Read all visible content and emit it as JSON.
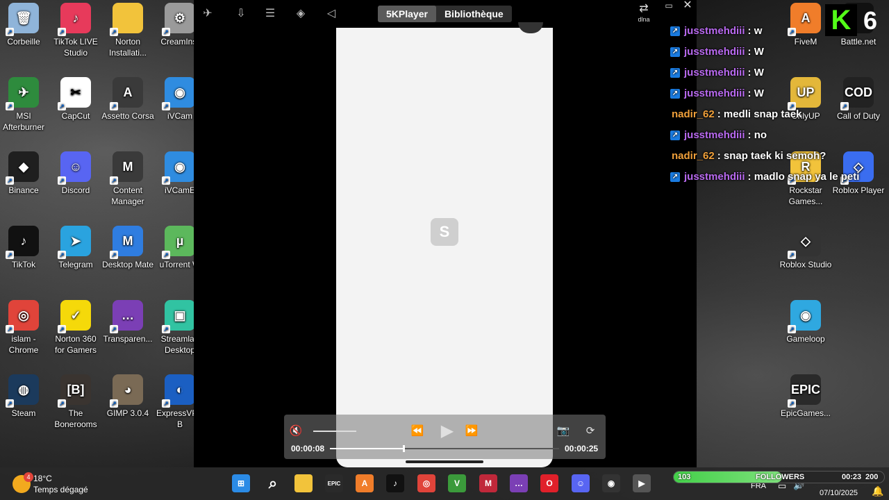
{
  "desktop_left": [
    {
      "label": "Corbeille",
      "icon": "recycle-bin-icon",
      "color": "#8fb4d9",
      "glyph": "🗑"
    },
    {
      "label": "TikTok LIVE Studio",
      "icon": "tiktok-live-studio-icon",
      "color": "#e73a5b",
      "glyph": "♪"
    },
    {
      "label": "Norton Installati...",
      "icon": "folder-icon",
      "color": "#f2c33b",
      "glyph": ""
    },
    {
      "label": "CreamInst",
      "icon": "gear-icon",
      "color": "#9a9a9a",
      "glyph": "⚙"
    },
    {
      "label": "MSI Afterburner",
      "icon": "msi-afterburner-icon",
      "color": "#2e8b3d",
      "glyph": "✈"
    },
    {
      "label": "CapCut",
      "icon": "capcut-icon",
      "color": "#ffffff",
      "glyph": "✂"
    },
    {
      "label": "Assetto Corsa",
      "icon": "assetto-corsa-icon",
      "color": "#3a3a3a",
      "glyph": "A"
    },
    {
      "label": "iVCam",
      "icon": "ivcam-icon",
      "color": "#2f8ce0",
      "glyph": "◉"
    },
    {
      "label": "Binance",
      "icon": "binance-icon",
      "color": "#1f1f1f",
      "glyph": "◆"
    },
    {
      "label": "Discord",
      "icon": "discord-icon",
      "color": "#5865f2",
      "glyph": "☺"
    },
    {
      "label": "Content Manager",
      "icon": "content-manager-icon",
      "color": "#3a3a3a",
      "glyph": "M"
    },
    {
      "label": "iVCamE",
      "icon": "ivcam-e-icon",
      "color": "#2f8ce0",
      "glyph": "◉"
    },
    {
      "label": "TikTok",
      "icon": "tiktok-icon",
      "color": "#111111",
      "glyph": "♪"
    },
    {
      "label": "Telegram",
      "icon": "telegram-icon",
      "color": "#2aa3df",
      "glyph": "➤"
    },
    {
      "label": "Desktop Mate",
      "icon": "desktop-mate-icon",
      "color": "#2f7de0",
      "glyph": "M"
    },
    {
      "label": "uTorrent W",
      "icon": "utorrent-icon",
      "color": "#5cb85c",
      "glyph": "µ"
    },
    {
      "label": "islam - Chrome",
      "icon": "chrome-icon",
      "color": "#e0443a",
      "glyph": "◎"
    },
    {
      "label": "Norton 360 for Gamers",
      "icon": "norton-360-icon",
      "color": "#f5d90a",
      "glyph": "✓"
    },
    {
      "label": "Transparen...",
      "icon": "transparent-icon",
      "color": "#7b3fb5",
      "glyph": "…"
    },
    {
      "label": "Streamlab Desktop",
      "icon": "streamlabs-icon",
      "color": "#31c3a2",
      "glyph": "▣"
    },
    {
      "label": "Steam",
      "icon": "steam-icon",
      "color": "#1b3a5c",
      "glyph": "◍"
    },
    {
      "label": "The Bonerooms",
      "icon": "bonerooms-icon",
      "color": "#3a3430",
      "glyph": "[B]"
    },
    {
      "label": "GIMP 3.0.4",
      "icon": "gimp-icon",
      "color": "#7a6a55",
      "glyph": "◕"
    },
    {
      "label": "ExpressVPN B",
      "icon": "vpn-icon",
      "color": "#1b5fc2",
      "glyph": "◐"
    }
  ],
  "desktop_right": [
    {
      "label": "FiveM",
      "icon": "fivem-icon",
      "color": "#f07d2a",
      "glyph": "A"
    },
    {
      "label": "Battle.net",
      "icon": "battlenet-icon",
      "color": "#111111",
      "glyph": ""
    },
    {
      "label": "OnlyUP",
      "icon": "onlyup-icon",
      "color": "#e3b73a",
      "glyph": "UP"
    },
    {
      "label": "Call of Duty",
      "icon": "call-of-duty-icon",
      "color": "#222222",
      "glyph": "COD"
    },
    {
      "label": "Rockstar Games...",
      "icon": "rockstar-icon",
      "color": "#f2c33b",
      "glyph": "R"
    },
    {
      "label": "Roblox Player",
      "icon": "roblox-player-icon",
      "color": "#3a6df0",
      "glyph": "◇"
    },
    {
      "label": "Roblox Studio",
      "icon": "roblox-studio-icon",
      "color": "#333333",
      "glyph": "◇"
    },
    {
      "label": "Gameloop",
      "icon": "gameloop-icon",
      "color": "#2fa8e0",
      "glyph": "◉"
    },
    {
      "label": "EpicGames...",
      "icon": "epic-games-icon",
      "color": "#2a2a2a",
      "glyph": "EPIC"
    }
  ],
  "kick_overlay": {
    "k": "K",
    "num": "6"
  },
  "player": {
    "tabs": [
      {
        "label": "5KPlayer"
      },
      {
        "label": "Bibliothèque"
      }
    ],
    "dlna_label": "dlna",
    "phone_logo": "S",
    "current_time": "00:00:08",
    "total_time": "00:00:25",
    "progress": 0.32
  },
  "chat": [
    {
      "user": "jusstmehdiii",
      "msg": ": w",
      "color": "#b96af0",
      "badge": true
    },
    {
      "user": "jusstmehdiii",
      "msg": ": W",
      "color": "#b96af0",
      "badge": true
    },
    {
      "user": "jusstmehdiii",
      "msg": ": W",
      "color": "#b96af0",
      "badge": true
    },
    {
      "user": "jusstmehdiii",
      "msg": ": W",
      "color": "#b96af0",
      "badge": true
    },
    {
      "user": "nadir_62",
      "msg": ": medli snap taek",
      "color": "#f0a03a",
      "badge": false
    },
    {
      "user": "jusstmehdiii",
      "msg": ": no",
      "color": "#b96af0",
      "badge": true
    },
    {
      "user": "nadir_62",
      "msg": ": snap taek ki semoh?",
      "color": "#f0a03a",
      "badge": false
    },
    {
      "user": "jusstmehdiii",
      "msg": ": madlo snap ya le peti",
      "color": "#b96af0",
      "badge": true
    }
  ],
  "taskbar": {
    "weather_temp": "18°C",
    "weather_desc": "Temps dégagé",
    "weather_badge": "4",
    "apps": [
      {
        "icon": "windows-start-icon",
        "color": "#2b8be6",
        "glyph": "⊞"
      },
      {
        "icon": "search-icon",
        "color": "transparent",
        "glyph": "⌕"
      },
      {
        "icon": "file-explorer-icon",
        "color": "#f2c33b",
        "glyph": ""
      },
      {
        "icon": "epic-games-icon",
        "color": "#2a2a2a",
        "glyph": "EPIC"
      },
      {
        "icon": "fivem-icon",
        "color": "#f07d2a",
        "glyph": "A"
      },
      {
        "icon": "tiktok-icon",
        "color": "#111111",
        "glyph": "♪"
      },
      {
        "icon": "chrome-icon",
        "color": "#e0443a",
        "glyph": "◎"
      },
      {
        "icon": "vortex-icon",
        "color": "#3b9a3b",
        "glyph": "V"
      },
      {
        "icon": "content-manager-icon",
        "color": "#c0283a",
        "glyph": "M"
      },
      {
        "icon": "transparent-icon",
        "color": "#7b3fb5",
        "glyph": "…"
      },
      {
        "icon": "opera-icon",
        "color": "#e0202a",
        "glyph": "O"
      },
      {
        "icon": "discord-icon",
        "color": "#5865f2",
        "glyph": "☺"
      },
      {
        "icon": "obs-icon",
        "color": "#333333",
        "glyph": "◉"
      },
      {
        "icon": "5kplayer-icon",
        "color": "#555555",
        "glyph": "▶"
      }
    ],
    "followers_count": "103",
    "followers_label": "FOLLOWERS",
    "followers_goal": "200",
    "followers_progress": 0.515,
    "stream_time": "00:23",
    "lang": "FRA",
    "date": "07/10/2025"
  }
}
